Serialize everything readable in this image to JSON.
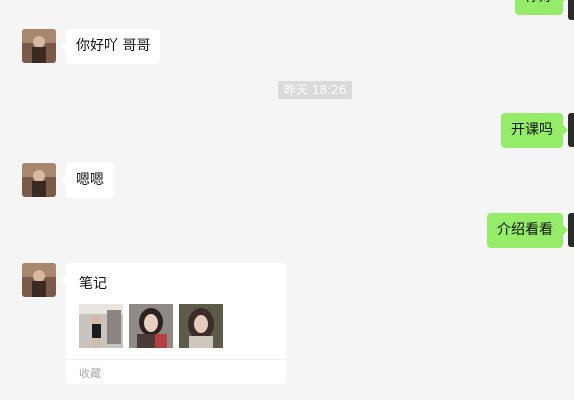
{
  "messages": {
    "top_partial": "你好",
    "m1_text": "你好吖 哥哥",
    "timestamp": "昨天 18:26",
    "m2_text": "开课吗",
    "m3_text": "嗯嗯",
    "m4_text": "介绍看看",
    "card": {
      "title": "笔记",
      "source": "收藏",
      "thumbnails": [
        "photo-thumbnail-1",
        "photo-thumbnail-2",
        "photo-thumbnail-3"
      ]
    }
  },
  "colors": {
    "background": "#f5f5f5",
    "self_bubble": "#95ec69",
    "other_bubble": "#ffffff",
    "timestamp_bg": "#dadada"
  }
}
